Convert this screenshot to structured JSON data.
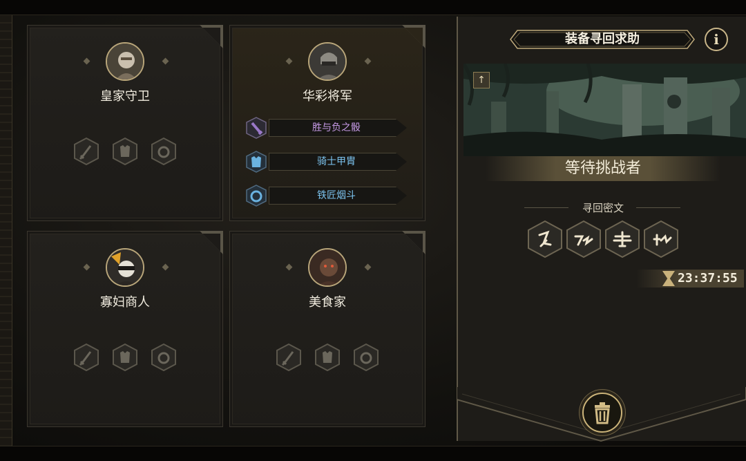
{
  "cards": [
    {
      "name": "皇家守卫",
      "avatar": "royal-guard-portrait",
      "slots": [
        "sword-icon",
        "armor-icon",
        "ring-icon"
      ]
    },
    {
      "name": "华彩将军",
      "avatar": "gilded-general-portrait",
      "equipment": [
        {
          "label": "胜与负之骰",
          "icon": "sword-icon",
          "color": "#c59ae6"
        },
        {
          "label": "骑士甲胄",
          "icon": "armor-icon",
          "color": "#7cc4f0"
        },
        {
          "label": "铁匠烟斗",
          "icon": "ring-icon",
          "color": "#7cc4f0"
        }
      ]
    },
    {
      "name": "寡妇商人",
      "avatar": "widow-merchant-portrait",
      "slots": [
        "sword-icon",
        "armor-icon",
        "ring-icon"
      ]
    },
    {
      "name": "美食家",
      "avatar": "gourmet-portrait",
      "slots": [
        "sword-icon",
        "armor-icon",
        "ring-icon"
      ]
    }
  ],
  "panel": {
    "title": "装备寻回求助",
    "info": "i",
    "status": "等待挑战者",
    "cipher_title": "寻回密文",
    "runes": [
      "rune-1",
      "rune-2",
      "rune-3",
      "rune-4"
    ],
    "timer": "23:37:55"
  },
  "colors": {
    "accent_gold": "#c9b27c",
    "epic_purple": "#c59ae6",
    "rare_blue": "#7cc4f0"
  }
}
